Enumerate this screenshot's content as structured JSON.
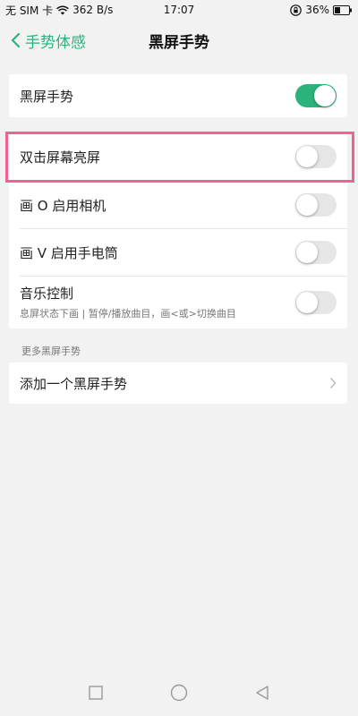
{
  "status_bar": {
    "carrier": "无 SIM 卡",
    "speed": "362 B/s",
    "time": "17:07",
    "battery": "36%"
  },
  "header": {
    "back_label": "手势体感",
    "title": "黑屏手势"
  },
  "main_toggle": {
    "label": "黑屏手势",
    "on": true
  },
  "gestures": [
    {
      "label": "双击屏幕亮屏",
      "sub": "",
      "on": false
    },
    {
      "label": "画 O 启用相机",
      "sub": "",
      "on": false
    },
    {
      "label": "画 V 启用手电筒",
      "sub": "",
      "on": false
    },
    {
      "label": "音乐控制",
      "sub": "息屏状态下画 | 暂停/播放曲目，画<或>切换曲目",
      "on": false
    }
  ],
  "more_section": {
    "title": "更多黑屏手势",
    "add_label": "添加一个黑屏手势"
  },
  "colors": {
    "accent": "#2bb37b",
    "highlight": "#f06292"
  },
  "icons": [
    "wifi-icon",
    "lock-icon",
    "battery-icon",
    "back-icon",
    "chevron-right-icon",
    "square-icon",
    "circle-icon",
    "triangle-icon"
  ]
}
